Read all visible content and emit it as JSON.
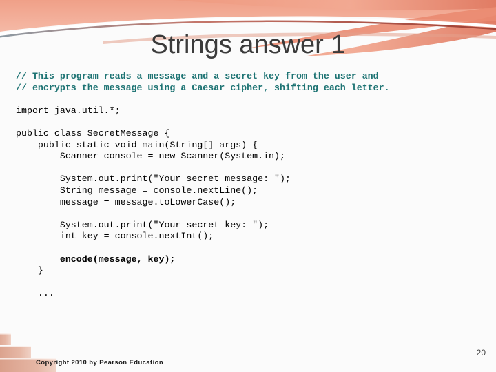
{
  "slide": {
    "title": "Strings answer 1",
    "page_number": "20",
    "copyright": "Copyright 2010 by Pearson Education",
    "theme": {
      "swoosh_color_light": "#f2a38d",
      "swoosh_color_dark": "#d9654f",
      "title_color": "#3b3b3b",
      "comment_color": "#1d7373",
      "code_color": "#000000",
      "background_color": "#fbfbfb",
      "steps_color": "#e0ab97"
    }
  },
  "code": {
    "language": "java",
    "lines": [
      {
        "text": "// This program reads a message and a secret key from the user and",
        "style": "cmt"
      },
      {
        "text": "// encrypts the message using a Caesar cipher, shifting each letter.",
        "style": "cmt"
      },
      {
        "text": "",
        "style": "blank"
      },
      {
        "text": "import java.util.*;",
        "style": "plain"
      },
      {
        "text": "",
        "style": "blank"
      },
      {
        "text": "public class SecretMessage {",
        "style": "plain"
      },
      {
        "text": "    public static void main(String[] args) {",
        "style": "plain"
      },
      {
        "text": "        Scanner console = new Scanner(System.in);",
        "style": "plain"
      },
      {
        "text": "",
        "style": "blank"
      },
      {
        "text": "        System.out.print(\"Your secret message: \");",
        "style": "plain"
      },
      {
        "text": "        String message = console.nextLine();",
        "style": "plain"
      },
      {
        "text": "        message = message.toLowerCase();",
        "style": "plain"
      },
      {
        "text": "",
        "style": "blank"
      },
      {
        "text": "        System.out.print(\"Your secret key: \");",
        "style": "plain"
      },
      {
        "text": "        int key = console.nextInt();",
        "style": "plain"
      },
      {
        "text": "",
        "style": "blank"
      },
      {
        "text": "        encode(message, key);",
        "style": "bold"
      },
      {
        "text": "    }",
        "style": "plain"
      },
      {
        "text": "",
        "style": "blank"
      },
      {
        "text": "    ...",
        "style": "plain"
      }
    ]
  }
}
